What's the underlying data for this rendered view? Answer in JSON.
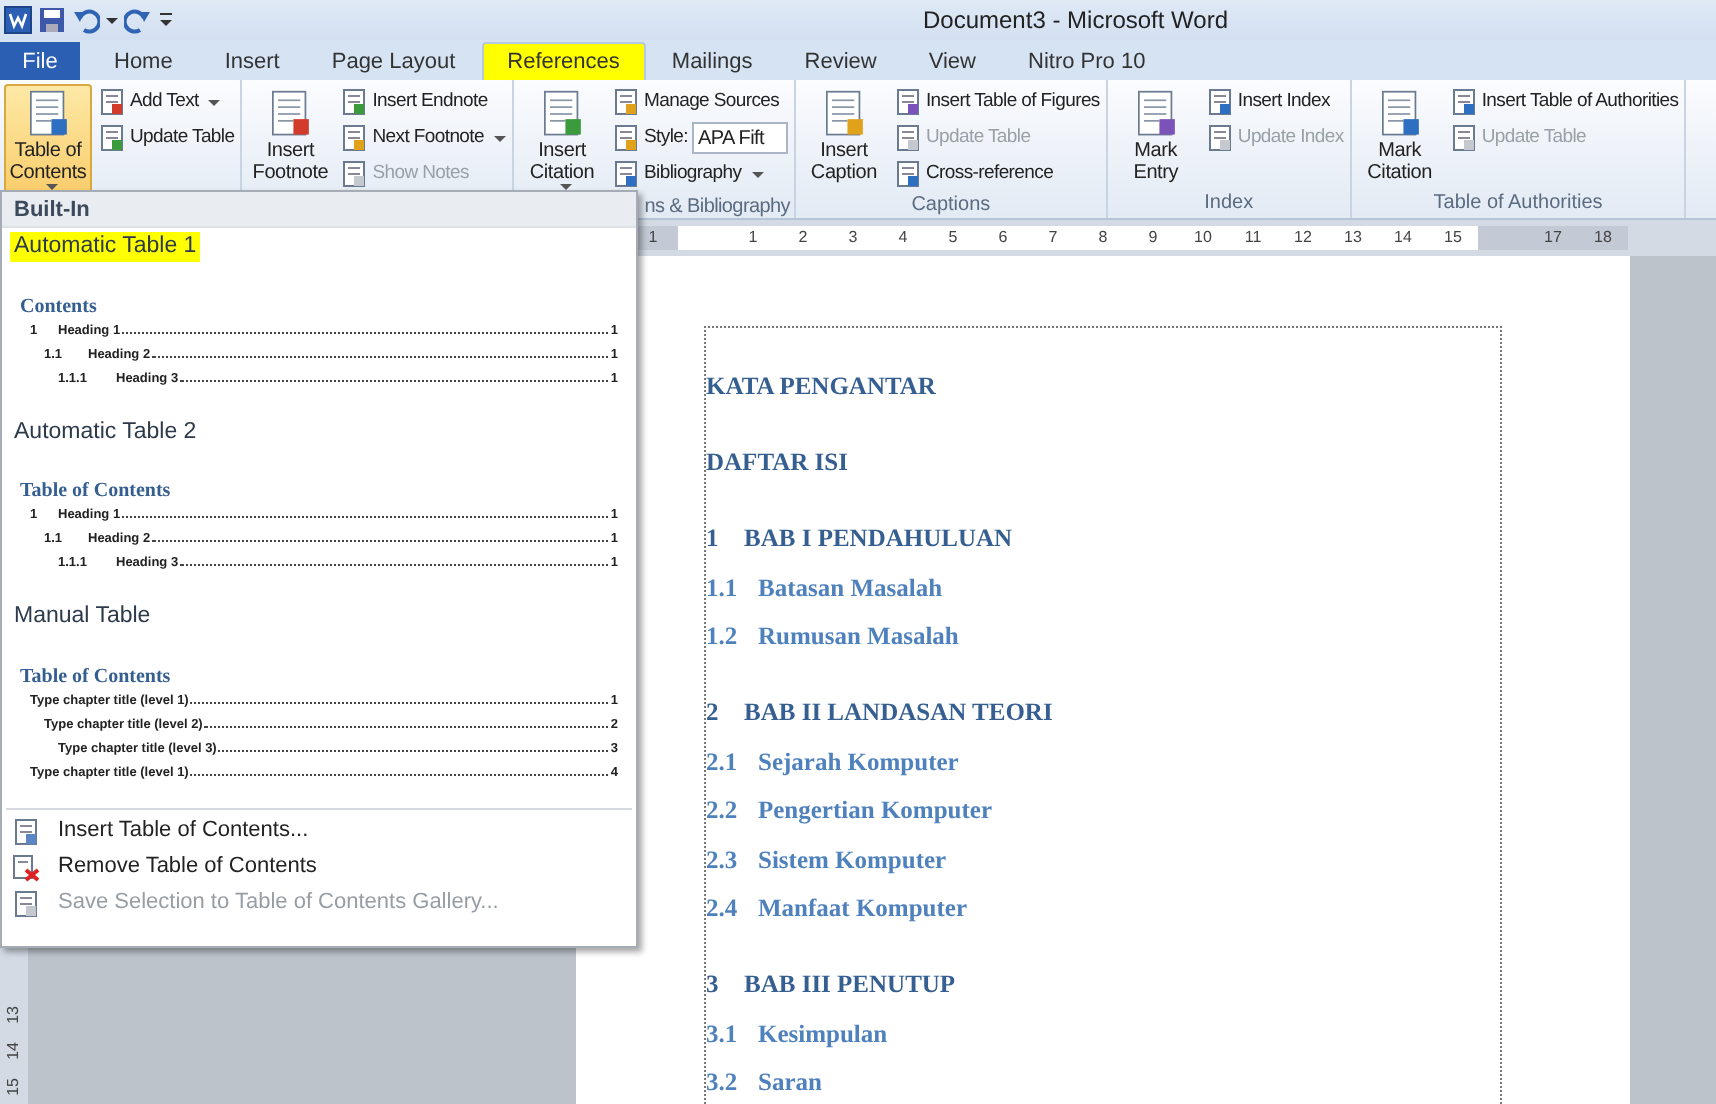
{
  "window": {
    "title": "Document3  -  Microsoft Word"
  },
  "tabs": [
    {
      "label": "File",
      "kind": "file",
      "selected": false,
      "highlighted": false
    },
    {
      "label": "Home",
      "kind": "tab",
      "selected": false,
      "highlighted": false
    },
    {
      "label": "Insert",
      "kind": "tab",
      "selected": false,
      "highlighted": false
    },
    {
      "label": "Page Layout",
      "kind": "tab",
      "selected": false,
      "highlighted": false
    },
    {
      "label": "References",
      "kind": "tab",
      "selected": true,
      "highlighted": true
    },
    {
      "label": "Mailings",
      "kind": "tab",
      "selected": false,
      "highlighted": false
    },
    {
      "label": "Review",
      "kind": "tab",
      "selected": false,
      "highlighted": false
    },
    {
      "label": "View",
      "kind": "tab",
      "selected": false,
      "highlighted": false
    },
    {
      "label": "Nitro Pro 10",
      "kind": "tab",
      "selected": false,
      "highlighted": false
    }
  ],
  "ribbon": {
    "groups": [
      {
        "large": {
          "label": "Table of Contents",
          "dropdown": true,
          "expanded": true
        },
        "small": [
          {
            "kind": "button",
            "label": "Add Text",
            "dropdown": true,
            "disabled": false
          },
          {
            "kind": "button",
            "label": "Update Table",
            "dropdown": false,
            "disabled": false
          }
        ]
      },
      {
        "large": {
          "label": "Insert Footnote",
          "dropdown": false,
          "expanded": false
        },
        "small": [
          {
            "kind": "button",
            "label": "Insert Endnote",
            "dropdown": false,
            "disabled": false
          },
          {
            "kind": "button",
            "label": "Next Footnote",
            "dropdown": true,
            "disabled": false
          },
          {
            "kind": "button",
            "label": "Show Notes",
            "dropdown": false,
            "disabled": true
          }
        ]
      },
      {
        "label": "ns & Bibliography",
        "large": {
          "label": "Insert Citation",
          "dropdown": true,
          "expanded": false
        },
        "small": [
          {
            "kind": "button",
            "label": "Manage Sources",
            "dropdown": false,
            "disabled": false
          },
          {
            "kind": "combo",
            "label": "Style:",
            "value": "APA Fift"
          },
          {
            "kind": "button",
            "label": "Bibliography",
            "dropdown": true,
            "disabled": false
          }
        ]
      },
      {
        "label": "Captions",
        "large": {
          "label": "Insert Caption",
          "dropdown": false,
          "expanded": false
        },
        "small": [
          {
            "kind": "button",
            "label": "Insert Table of Figures",
            "dropdown": false,
            "disabled": false
          },
          {
            "kind": "button",
            "label": "Update Table",
            "dropdown": false,
            "disabled": true
          },
          {
            "kind": "button",
            "label": "Cross-reference",
            "dropdown": false,
            "disabled": false
          }
        ]
      },
      {
        "label": "Index",
        "large": {
          "label": "Mark Entry",
          "dropdown": false,
          "expanded": false
        },
        "small": [
          {
            "kind": "button",
            "label": "Insert Index",
            "dropdown": false,
            "disabled": false
          },
          {
            "kind": "button",
            "label": "Update Index",
            "dropdown": false,
            "disabled": true
          }
        ]
      },
      {
        "label": "Table of Authorities",
        "large": {
          "label": "Mark Citation",
          "dropdown": false,
          "expanded": false
        },
        "small": [
          {
            "kind": "button",
            "label": "Insert Table of Authorities",
            "dropdown": false,
            "disabled": false
          },
          {
            "kind": "button",
            "label": "Update Table",
            "dropdown": false,
            "disabled": true
          }
        ]
      }
    ]
  },
  "ruler": {
    "left_margin_labels": [
      "1"
    ],
    "body_labels": [
      "1",
      "2",
      "3",
      "4",
      "5",
      "6",
      "7",
      "8",
      "9",
      "10",
      "11",
      "12",
      "13",
      "14",
      "15"
    ],
    "right_margin_labels": [
      "17",
      "18"
    ]
  },
  "vertical_ruler": {
    "labels": [
      "13",
      "14",
      "15"
    ]
  },
  "document": {
    "lines": [
      {
        "kind": "heading",
        "text": "KATA PENGANTAR"
      },
      {
        "kind": "heading",
        "text": "DAFTAR ISI"
      },
      {
        "kind": "chapter",
        "number": "1",
        "text": "BAB I PENDAHULUAN"
      },
      {
        "kind": "section",
        "number": "1.1",
        "text": "Batasan Masalah"
      },
      {
        "kind": "section",
        "number": "1.2",
        "text": "Rumusan Masalah"
      },
      {
        "kind": "chapter",
        "number": "2",
        "text": "BAB II LANDASAN TEORI"
      },
      {
        "kind": "section",
        "number": "2.1",
        "text": "Sejarah Komputer"
      },
      {
        "kind": "section",
        "number": "2.2",
        "text": "Pengertian  Komputer"
      },
      {
        "kind": "section",
        "number": "2.3",
        "text": "Sistem  Komputer"
      },
      {
        "kind": "section",
        "number": "2.4",
        "text": "Manfaat Komputer"
      },
      {
        "kind": "chapter",
        "number": "3",
        "text": "BAB III PENUTUP"
      },
      {
        "kind": "section",
        "number": "3.1",
        "text": "Kesimpulan"
      },
      {
        "kind": "section",
        "number": "3.2",
        "text": "Saran"
      }
    ]
  },
  "toc_menu": {
    "header": "Built-In",
    "gallery": [
      {
        "name": "Automatic Table 1",
        "highlighted": true,
        "preview": {
          "title": "Contents",
          "entries": [
            {
              "number": "1",
              "text": "Heading 1",
              "page": "1",
              "children": [
                {
                  "number": "1.1",
                  "text": "Heading 2",
                  "page": "1",
                  "children": [
                    {
                      "number": "1.1.1",
                      "text": "Heading 3",
                      "page": "1"
                    }
                  ]
                }
              ]
            }
          ]
        }
      },
      {
        "name": "Automatic Table 2",
        "highlighted": false,
        "preview": {
          "title": "Table of Contents",
          "entries": [
            {
              "number": "1",
              "text": "Heading 1",
              "page": "1",
              "children": [
                {
                  "number": "1.1",
                  "text": "Heading 2",
                  "page": "1",
                  "children": [
                    {
                      "number": "1.1.1",
                      "text": "Heading 3",
                      "page": "1"
                    }
                  ]
                }
              ]
            }
          ]
        }
      },
      {
        "name": "Manual Table",
        "highlighted": false,
        "preview": {
          "title": "Table of Contents",
          "entries": [
            {
              "text": "Type chapter title (level 1)",
              "page": "1",
              "children": [
                {
                  "text": "Type chapter title (level 2)",
                  "page": "2",
                  "children": [
                    {
                      "text": "Type chapter title (level 3)",
                      "page": "3"
                    }
                  ]
                }
              ]
            },
            {
              "text": "Type chapter title (level 1)",
              "page": "4"
            }
          ]
        }
      }
    ],
    "commands": [
      {
        "label": "Insert Table of Contents...",
        "kind": "insert",
        "disabled": false
      },
      {
        "label": "Remove Table of Contents",
        "kind": "remove",
        "disabled": false
      },
      {
        "label": "Save Selection to Table of Contents Gallery...",
        "kind": "save",
        "disabled": true
      }
    ]
  }
}
